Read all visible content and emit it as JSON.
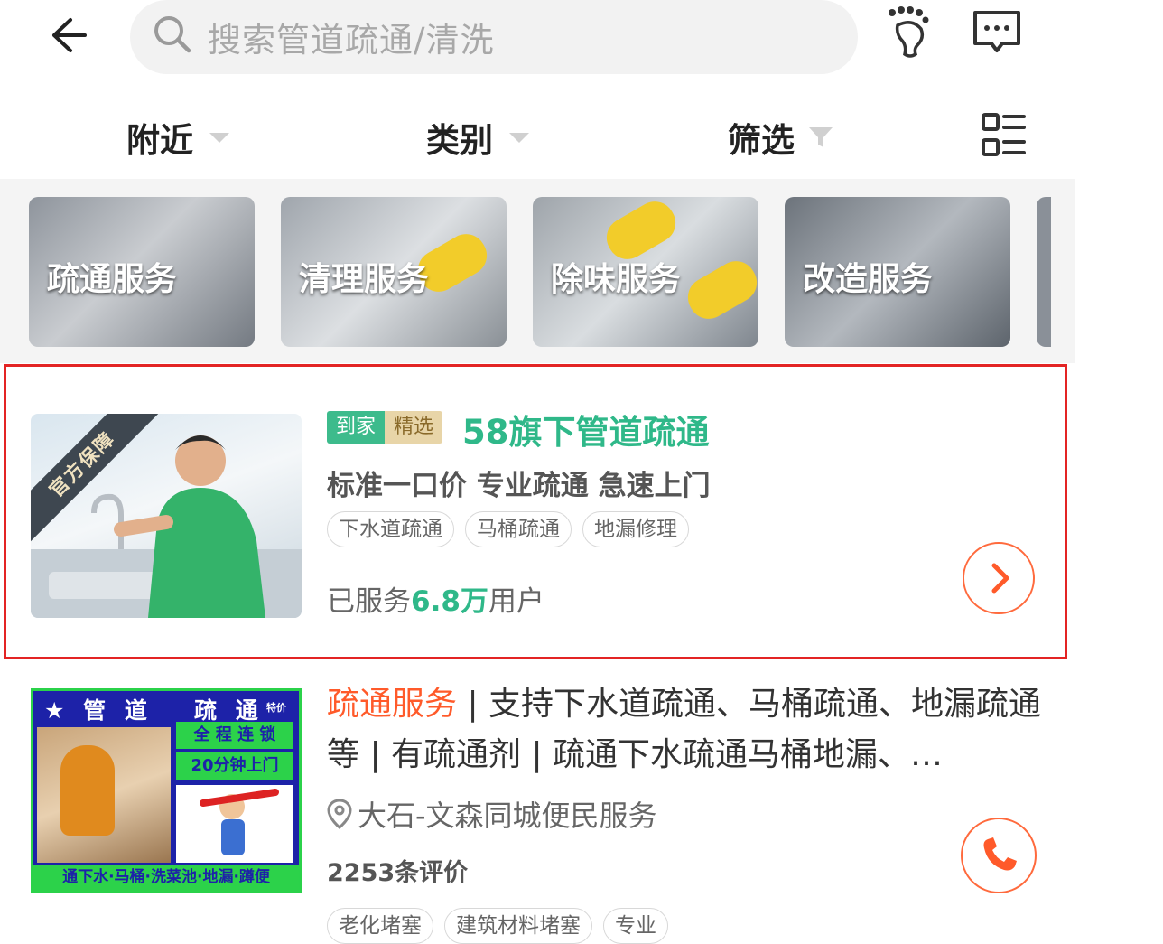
{
  "search": {
    "placeholder": "搜索管道疏通/清洗"
  },
  "filters": {
    "nearby": "附近",
    "category": "类别",
    "filter": "筛选"
  },
  "categories": [
    {
      "label": "疏通服务"
    },
    {
      "label": "清理服务"
    },
    {
      "label": "除味服务"
    },
    {
      "label": "改造服务"
    }
  ],
  "featured": {
    "badge": "官方保障",
    "tag_a": "到家",
    "tag_b": "精选",
    "title": "58旗下管道疏通",
    "subtitle": "标准一口价 专业疏通 急速上门",
    "chips": [
      "下水道疏通",
      "马桶疏通",
      "地漏修理"
    ],
    "served_prefix": "已服务",
    "served_num": "6.8万",
    "served_suffix": "用户"
  },
  "listing": {
    "image_top_left": "★ 管 道",
    "image_top_right": "疏 通",
    "image_top_tiny": "特价",
    "image_badge1": "全 程 连 锁",
    "image_badge2": "20分钟上门",
    "image_bottom": "通下水·马桶·洗菜池·地漏·蹲便",
    "title_highlight": "疏通服务",
    "title_rest": " | 支持下水道疏通、马桶疏通、地漏疏通等 | 有疏通剂 | 疏通下水疏通马桶地漏、…",
    "location": "大石-文森同城便民服务",
    "reviews": "2253条评价",
    "chips": [
      "老化堵塞",
      "建筑材料堵塞",
      "专业"
    ]
  },
  "colors": {
    "accent_green": "#2fb889",
    "accent_orange": "#ff6a3d",
    "highlight_red": "#e32424"
  }
}
